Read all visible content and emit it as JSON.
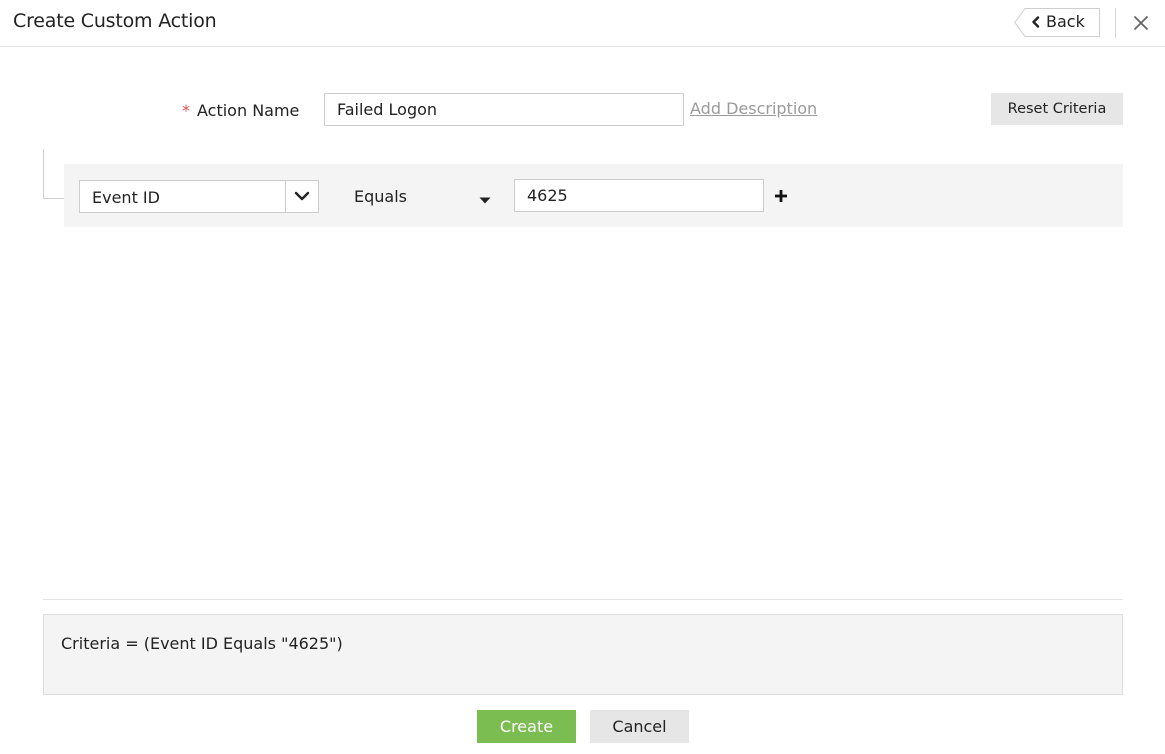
{
  "header": {
    "title": "Create Custom Action",
    "back_label": "Back",
    "back_icon": "chevron-left-icon",
    "close_icon": "close-icon"
  },
  "form": {
    "required_mark": "*",
    "action_name_label": "Action Name",
    "action_name_value": "Failed Logon",
    "add_description_link": "Add Description",
    "reset_criteria_label": "Reset Criteria"
  },
  "criteria": {
    "field_value": "Event ID",
    "operator_value": "Equals",
    "condition_value": "4625",
    "add_icon": "plus-icon"
  },
  "summary": {
    "text": "Criteria = (Event ID Equals \"4625\")"
  },
  "footer": {
    "create_label": "Create",
    "cancel_label": "Cancel"
  },
  "colors": {
    "create_green": "#7cbd52",
    "required_red": "#e05555",
    "link_gray": "#9a9a9a",
    "panel_gray": "#f4f4f4"
  }
}
